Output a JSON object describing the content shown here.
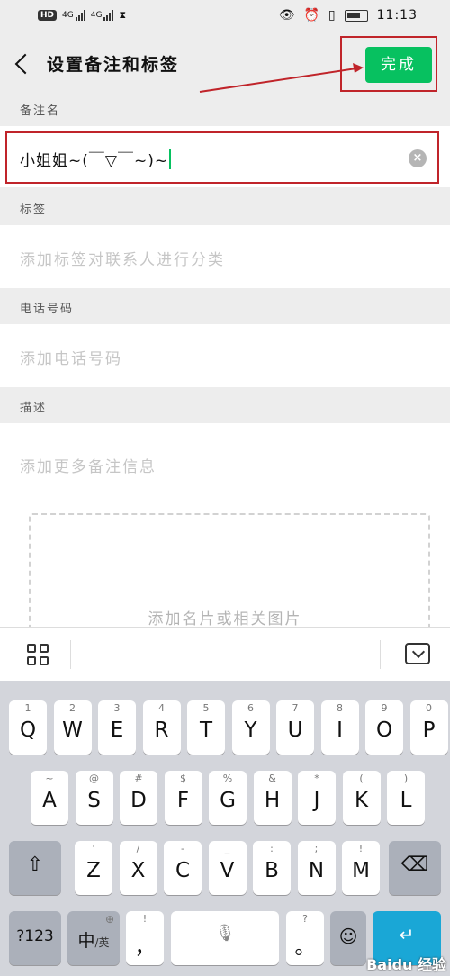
{
  "status_bar": {
    "hd_badge": "HD",
    "network_1": "4G",
    "network_2": "4G",
    "time": "11:13"
  },
  "header": {
    "title": "设置备注和标签",
    "done_label": "完成"
  },
  "remark": {
    "section_label": "备注名",
    "value": "小姐姐~(￣▽￣~)~"
  },
  "tags": {
    "section_label": "标签",
    "placeholder": "添加标签对联系人进行分类"
  },
  "phone": {
    "section_label": "电话号码",
    "placeholder": "添加电话号码"
  },
  "description": {
    "section_label": "描述",
    "placeholder": "添加更多备注信息"
  },
  "card": {
    "placeholder": "添加名片或相关图片"
  },
  "keyboard": {
    "row1": [
      {
        "sub": "1",
        "main": "Q"
      },
      {
        "sub": "2",
        "main": "W"
      },
      {
        "sub": "3",
        "main": "E"
      },
      {
        "sub": "4",
        "main": "R"
      },
      {
        "sub": "5",
        "main": "T"
      },
      {
        "sub": "6",
        "main": "Y"
      },
      {
        "sub": "7",
        "main": "U"
      },
      {
        "sub": "8",
        "main": "I"
      },
      {
        "sub": "9",
        "main": "O"
      },
      {
        "sub": "0",
        "main": "P"
      }
    ],
    "row2": [
      {
        "sub": "~",
        "main": "A"
      },
      {
        "sub": "@",
        "main": "S"
      },
      {
        "sub": "#",
        "main": "D"
      },
      {
        "sub": "$",
        "main": "F"
      },
      {
        "sub": "%",
        "main": "G"
      },
      {
        "sub": "&",
        "main": "H"
      },
      {
        "sub": "*",
        "main": "J"
      },
      {
        "sub": "(",
        "main": "K"
      },
      {
        "sub": ")",
        "main": "L"
      }
    ],
    "row3": [
      {
        "sub": "'",
        "main": "Z"
      },
      {
        "sub": "/",
        "main": "X"
      },
      {
        "sub": "-",
        "main": "C"
      },
      {
        "sub": "_",
        "main": "V"
      },
      {
        "sub": ":",
        "main": "B"
      },
      {
        "sub": ";",
        "main": "N"
      },
      {
        "sub": "!",
        "main": "M"
      }
    ],
    "num_key": "?123",
    "lang_key": "中",
    "lang_key_sub": "/英",
    "comma_key": "，",
    "comma_sub": "!",
    "period_key": "。",
    "period_sub": "?",
    "watermark": "Baidu 经验"
  },
  "colors": {
    "accent": "#07c160",
    "highlight_box": "#c0242a"
  }
}
